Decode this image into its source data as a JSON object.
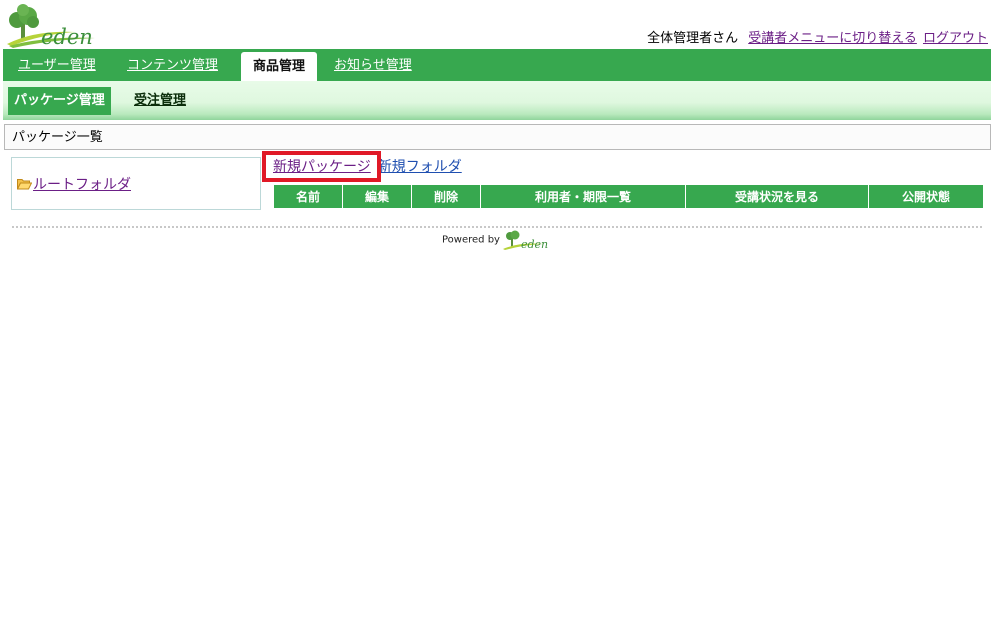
{
  "header": {
    "logo_text": "eden",
    "user_greeting": "全体管理者さん",
    "switch_menu_link": "受講者メニューに切り替える",
    "logout_link": "ログアウト"
  },
  "main_nav": {
    "tabs": [
      {
        "label": "ユーザー管理",
        "active": false
      },
      {
        "label": "コンテンツ管理",
        "active": false
      },
      {
        "label": "商品管理",
        "active": true
      },
      {
        "label": "お知らせ管理",
        "active": false
      }
    ]
  },
  "sub_nav": {
    "items": [
      {
        "label": "パッケージ管理",
        "active": true
      },
      {
        "label": "受注管理",
        "active": false
      }
    ]
  },
  "section_title": "パッケージ一覧",
  "folder_tree": {
    "root_label": "ルートフォルダ",
    "folder_icon": "folder-open-icon"
  },
  "actions": {
    "new_package": "新規パッケージ",
    "new_folder": "新規フォルダ"
  },
  "table": {
    "columns": [
      "名前",
      "編集",
      "削除",
      "利用者・期限一覧",
      "受講状況を見る",
      "公開状態"
    ]
  },
  "footer": {
    "powered_by": "Powered by",
    "logo_text": "eden"
  },
  "colors": {
    "brand_green": "#37a84f",
    "highlight_red": "#e01927",
    "visited_link": "#6b1f86"
  }
}
